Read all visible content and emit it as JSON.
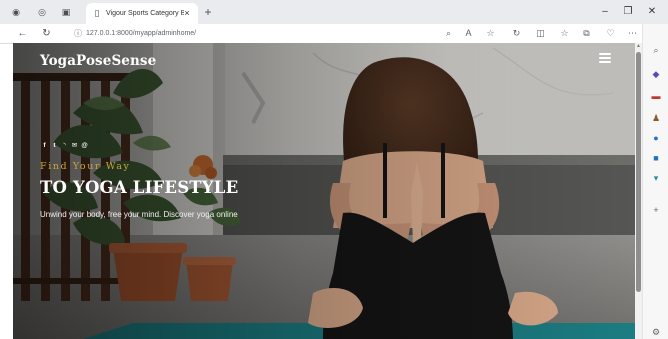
{
  "browser": {
    "tab_title": "Vigour Sports Category Bootstrap",
    "tab_close": "×",
    "new_tab": "+",
    "minimize": "–",
    "restore": "❐",
    "close": "✕",
    "url": "127.0.0.1:8000/myapp/adminhome/",
    "back": "←",
    "refresh": "↻",
    "info": "ⓘ",
    "more": "⋯",
    "sidebar_add": "+"
  },
  "page": {
    "brand": "YogaPoseSense",
    "hero": {
      "subtitle": "Find Your Way",
      "title": "TO YOGA LIFESTYLE",
      "description": "Unwind your body, free your mind. Discover yoga online"
    },
    "social": [
      {
        "name": "facebook-icon",
        "glyph": "f"
      },
      {
        "name": "twitter-icon",
        "glyph": "t"
      },
      {
        "name": "rss-icon",
        "glyph": "◝"
      },
      {
        "name": "email-icon",
        "glyph": "✉"
      },
      {
        "name": "at-icon",
        "glyph": "@"
      }
    ]
  },
  "colors": {
    "accent_gold": "#c9a53e",
    "mat_teal": "#1b7d82",
    "dress": "#151515"
  }
}
